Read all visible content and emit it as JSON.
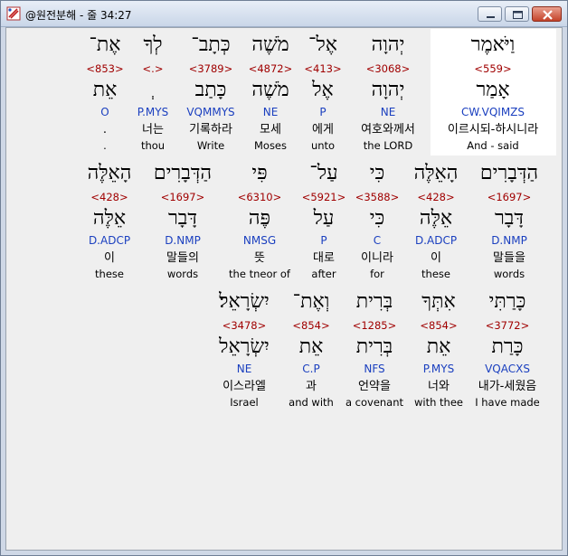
{
  "window": {
    "title": "@원전분해 - 줄 34:27"
  },
  "rows": [
    {
      "words": [
        {
          "hebrew": "וַיֹּאמֶר",
          "strong": "<559>",
          "lemma": "אָמַר",
          "code": "CW.VQIMZS",
          "korean": "이르시되-하시니라",
          "english": "And - said"
        },
        {
          "hebrew": "יְהוָה",
          "strong": "<3068>",
          "lemma": "יְהוָה",
          "code": "NE",
          "korean": "여호와께서",
          "english": "the LORD"
        },
        {
          "hebrew": "אֶל־",
          "strong": "<413>",
          "lemma": "אֶל",
          "code": "P",
          "korean": "에게",
          "english": "unto"
        },
        {
          "hebrew": "מֹשֶׁה",
          "strong": "<4872>",
          "lemma": "מֹשֶׁה",
          "code": "NE",
          "korean": "모세",
          "english": "Moses"
        },
        {
          "hebrew": "כְּתָב־",
          "strong": "<3789>",
          "lemma": "כָּתַב",
          "code": "VQMMYS",
          "korean": "기록하라",
          "english": "Write"
        },
        {
          "hebrew": "לְךָ",
          "strong": "<.>",
          "lemma": "ְ",
          "code": "P.MYS",
          "korean": "너는",
          "english": "thou"
        },
        {
          "hebrew": "אֶת־",
          "strong": "<853>",
          "lemma": "אֵת",
          "code": "O",
          "korean": ".",
          "english": "."
        }
      ]
    },
    {
      "words": [
        {
          "hebrew": "הַדְּבָרִים",
          "strong": "<1697>",
          "lemma": "דָּבָר",
          "code": "D.NMP",
          "korean": "말들을",
          "english": "words"
        },
        {
          "hebrew": "הָאֵלֶּה",
          "strong": "<428>",
          "lemma": "אֵלֶּה",
          "code": "D.ADCP",
          "korean": "이",
          "english": "these"
        },
        {
          "hebrew": "כִּי",
          "strong": "<3588>",
          "lemma": "כִּי",
          "code": "C",
          "korean": "이니라",
          "english": "for"
        },
        {
          "hebrew": "עַל־",
          "strong": "<5921>",
          "lemma": "עַל",
          "code": "P",
          "korean": "대로",
          "english": "after"
        },
        {
          "hebrew": "פִּי",
          "strong": "<6310>",
          "lemma": "פֶּה",
          "code": "NMSG",
          "korean": "뜻",
          "english": "the tneor of"
        },
        {
          "hebrew": "הַדְּבָרִים",
          "strong": "<1697>",
          "lemma": "דָּבָר",
          "code": "D.NMP",
          "korean": "말들의",
          "english": "words"
        },
        {
          "hebrew": "הָאֵלֶּה",
          "strong": "<428>",
          "lemma": "אֵלֶּה",
          "code": "D.ADCP",
          "korean": "이",
          "english": "these"
        }
      ]
    },
    {
      "words": [
        {
          "hebrew": "כָּרַתִּי",
          "strong": "<3772>",
          "lemma": "כָּרַת",
          "code": "VQACXS",
          "korean": "내가-세웠음",
          "english": "I have made"
        },
        {
          "hebrew": "אִתְּךָ",
          "strong": "<854>",
          "lemma": "אֵת",
          "code": "P.MYS",
          "korean": "너와",
          "english": "with thee"
        },
        {
          "hebrew": "בְּרִית",
          "strong": "<1285>",
          "lemma": "בְּרִית",
          "code": "NFS",
          "korean": "언약을",
          "english": "a covenant"
        },
        {
          "hebrew": "וְאֶת־",
          "strong": "<854>",
          "lemma": "אֵת",
          "code": "C.P",
          "korean": "과",
          "english": "and with"
        },
        {
          "hebrew": "יִשְׂרָאֵל׃",
          "strong": "<3478>",
          "lemma": "יִשְׂרָאֵל",
          "code": "NE",
          "korean": "이스라엘",
          "english": "Israel"
        }
      ]
    }
  ]
}
